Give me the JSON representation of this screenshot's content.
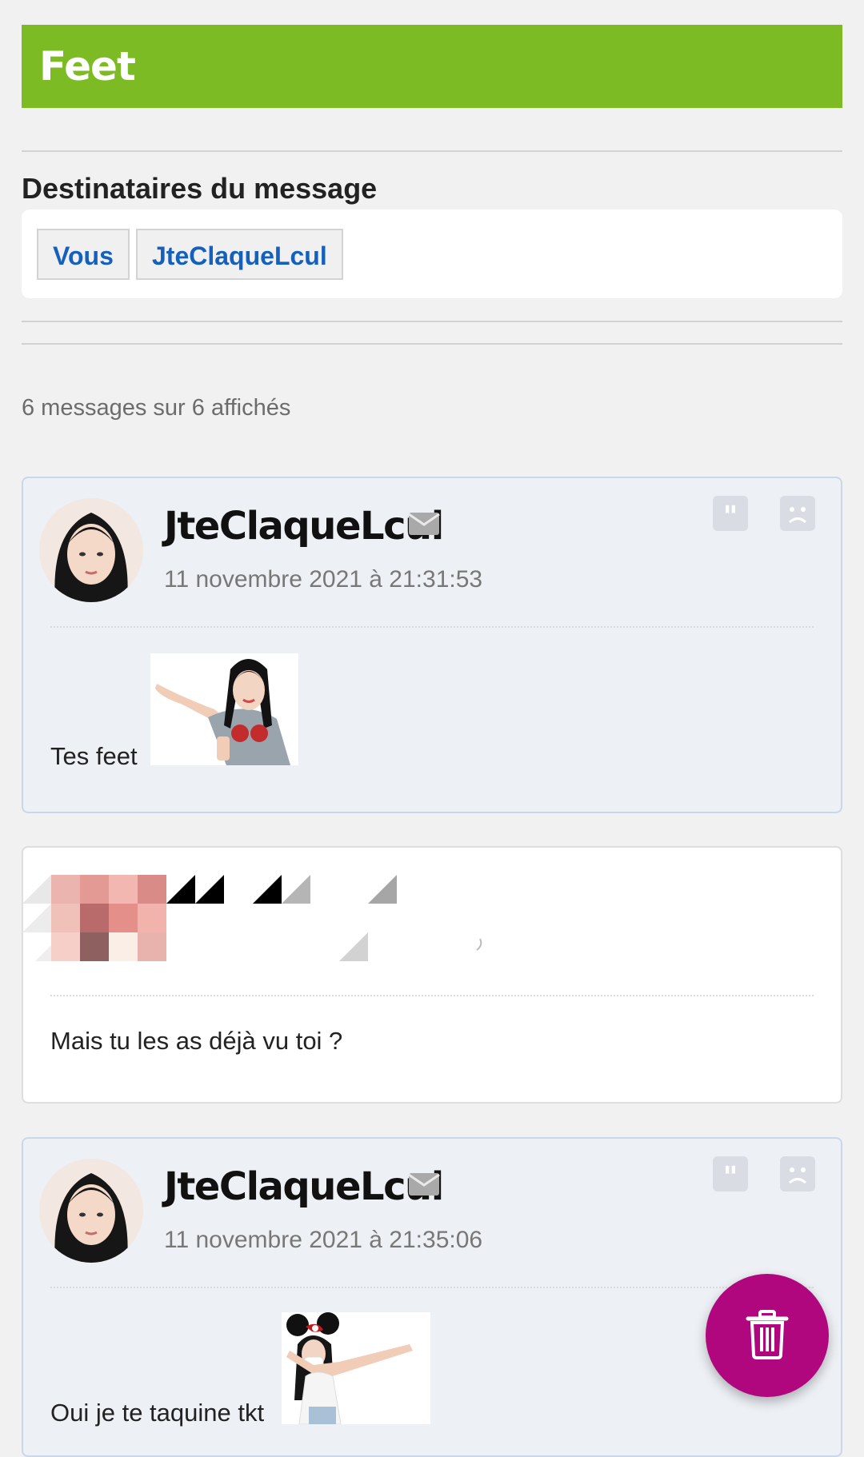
{
  "topic": {
    "title": "Feet"
  },
  "recipients": {
    "title": "Destinataires du message",
    "users": [
      "Vous",
      "JteClaqueLcul"
    ]
  },
  "thread": {
    "count_text": "6 messages sur 6 affichés"
  },
  "messages": [
    {
      "author": "JteClaqueLcul",
      "date": "11 novembre 2021 à 21:31:53",
      "text": "Tes feet",
      "has_sticker": true
    },
    {
      "author": "",
      "date": "",
      "text": "Mais tu les as déjà vu toi ?",
      "pixelated_header": true
    },
    {
      "author": "JteClaqueLcul",
      "date": "11 novembre 2021 à 21:35:06",
      "text": "Oui je te taquine tkt",
      "has_sticker": true
    }
  ],
  "icons": {
    "mail": "mail-icon",
    "quote": "quote-icon",
    "report": "sad-face-icon",
    "delete": "trash-icon"
  },
  "colors": {
    "topic_bar": "#7dbb25",
    "link": "#1660bd",
    "fab": "#b0077e"
  }
}
